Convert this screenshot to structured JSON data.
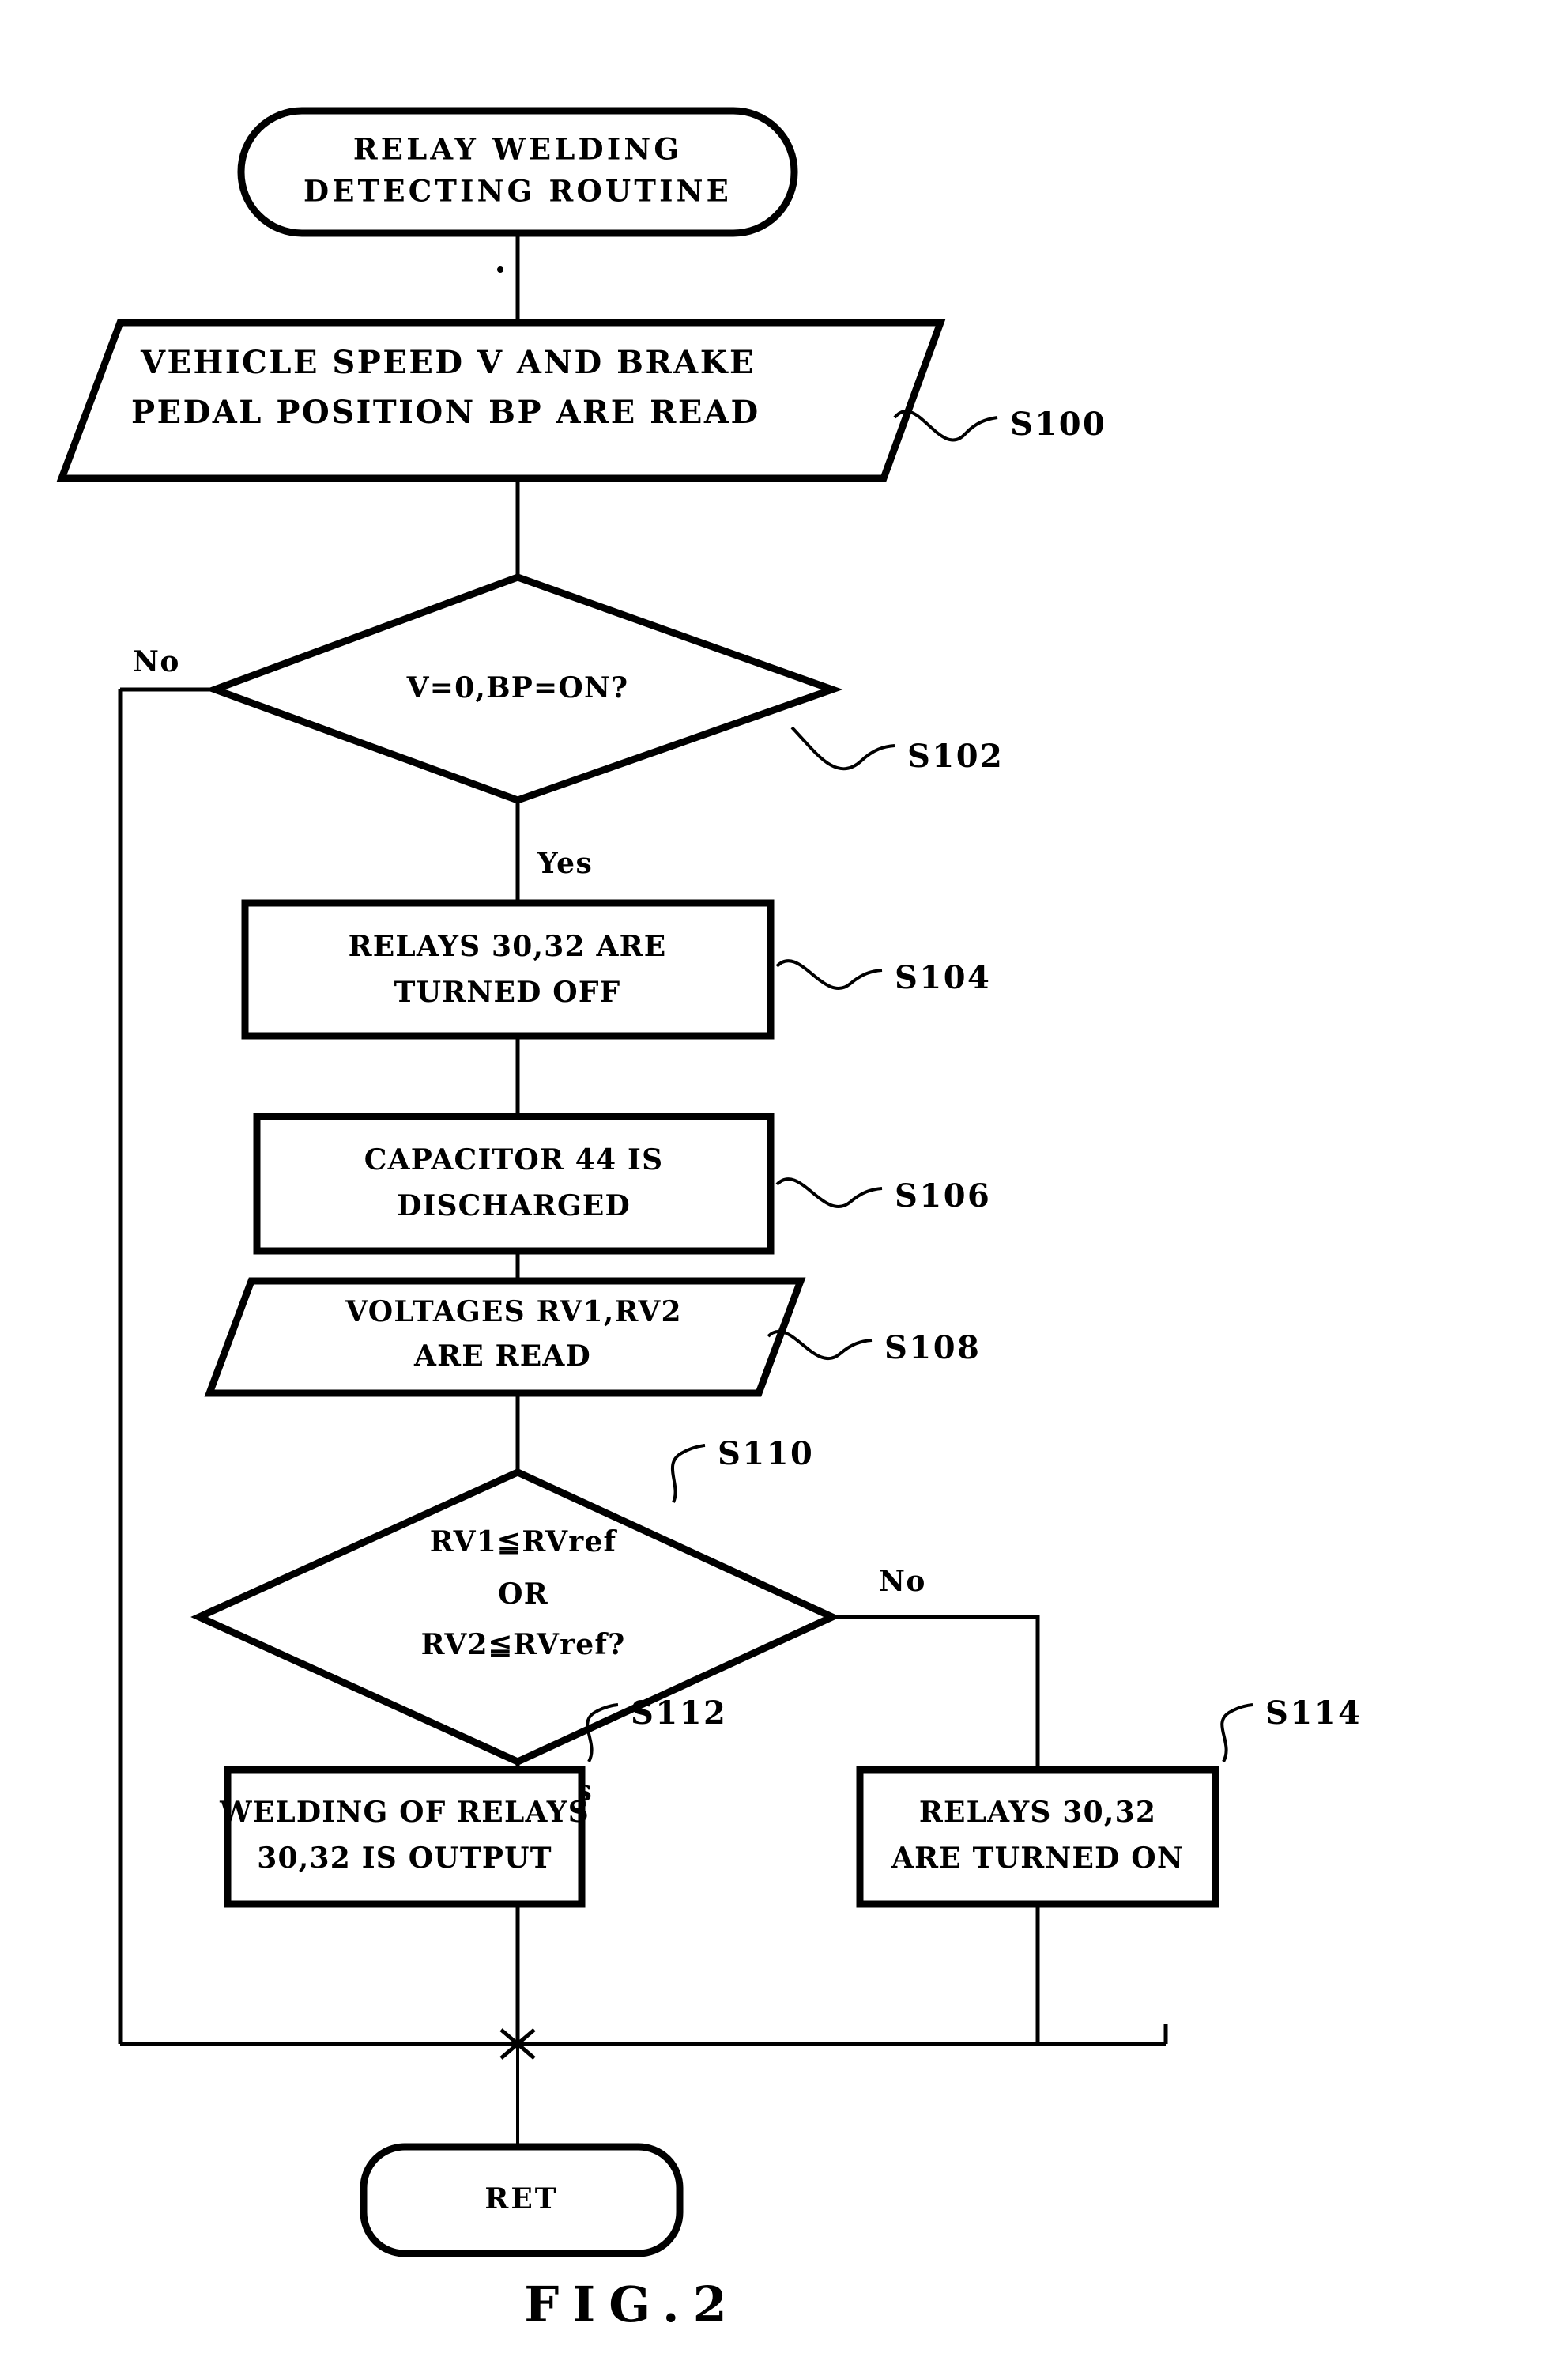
{
  "figure": {
    "caption": "FIG.2",
    "title": "RELAY WELDING DETECTING ROUTINE"
  },
  "nodes": {
    "start": {
      "type": "terminal",
      "line1": "RELAY WELDING",
      "line2": "DETECTING ROUTINE"
    },
    "s100": {
      "type": "io",
      "step": "S100",
      "line1": "VEHICLE SPEED V AND BRAKE",
      "line2": "PEDAL POSITION BP ARE READ"
    },
    "s102": {
      "type": "decision",
      "step": "S102",
      "line1": "V=0,BP=ON?",
      "yes_label": "Yes",
      "no_label": "No"
    },
    "s104": {
      "type": "process",
      "step": "S104",
      "line1": "RELAYS 30,32 ARE",
      "line2": "TURNED OFF"
    },
    "s106": {
      "type": "process",
      "step": "S106",
      "line1": "CAPACITOR 44 IS",
      "line2": "DISCHARGED"
    },
    "s108": {
      "type": "io",
      "step": "S108",
      "line1": "VOLTAGES RV1,RV2",
      "line2": "ARE READ"
    },
    "s110": {
      "type": "decision",
      "step": "S110",
      "line1": "RV1≦RVref",
      "line2": "OR",
      "line3": "RV2≦RVref?",
      "yes_label": "Yes",
      "no_label": "No"
    },
    "s112": {
      "type": "process",
      "step": "S112",
      "line1": "WELDING OF RELAYS",
      "line2": "30,32 IS OUTPUT"
    },
    "s114": {
      "type": "process",
      "step": "S114",
      "line1": "RELAYS 30,32",
      "line2": "ARE TURNED ON"
    },
    "ret": {
      "type": "terminal",
      "line1": "RET"
    }
  },
  "colors": {
    "ink": "#000000",
    "paper": "#ffffff"
  }
}
